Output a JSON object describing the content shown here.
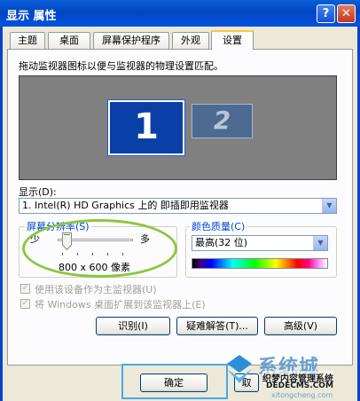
{
  "window": {
    "title": "显示 属性",
    "help_glyph": "?",
    "close_glyph": "✕"
  },
  "tabs": [
    "主题",
    "桌面",
    "屏幕保护程序",
    "外观",
    "设置"
  ],
  "settings": {
    "instruction": "拖动监视器图标以便与监视器的物理设置匹配。",
    "monitor1_label": "1",
    "monitor2_label": "2",
    "display_label": "显示(D):",
    "display_value": "1. Intel(R) HD Graphics 上的 即插即用监视器",
    "resolution": {
      "label": "屏幕分辨率(S)",
      "less": "少",
      "more": "多",
      "value": "800 x 600 像素",
      "level_fraction": 0.1
    },
    "color_quality": {
      "label": "颜色质量(C)",
      "value": "最高(32 位)"
    },
    "primary_monitor_checkbox": "使用该设备作为主监视器(U)",
    "extend_desktop_checkbox": "将 Windows 桌面扩展到该监视器上(E)",
    "identify_button": "识别(I)",
    "troubleshoot_button": "疑难解答(T)...",
    "advanced_button": "高级(V)"
  },
  "footer": {
    "ok_button": "确定",
    "cancel_button_partial": "取"
  },
  "watermark": {
    "brand": "系统城",
    "line1": "织梦内容管理系统",
    "line2": "DEDECMS.COM",
    "line3": "xitongcheng.com"
  },
  "colors": {
    "title_bar": "#0346c2",
    "accent_blue": "#0046d5",
    "highlight_oval": "#8dc63f",
    "ok_highlight": "#4aa6e8"
  }
}
